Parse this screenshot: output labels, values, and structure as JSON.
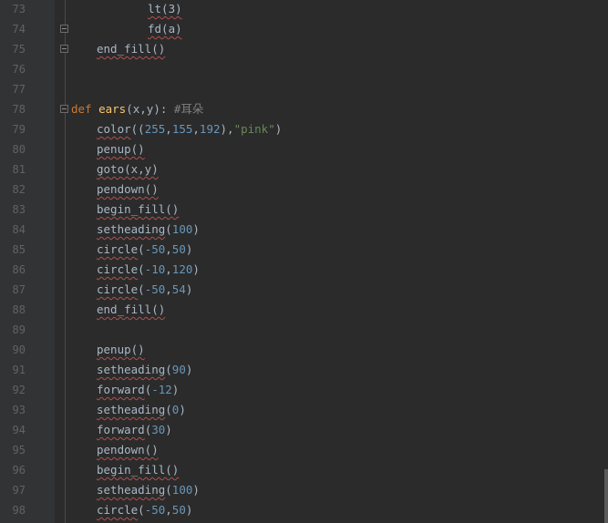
{
  "editor": {
    "lines": [
      {
        "num": "73",
        "text": "lt(3)"
      },
      {
        "num": "74",
        "text": "fd(a)"
      },
      {
        "num": "75",
        "text": "end_fill()"
      },
      {
        "num": "76",
        "text": ""
      },
      {
        "num": "77",
        "text": ""
      },
      {
        "num": "78",
        "def_kw": "def",
        "def_name": "ears",
        "def_rest": "(x,y):",
        "comment": "#耳朵"
      },
      {
        "num": "79",
        "call": "color",
        "args_a": "((",
        "n1": "255",
        "c1": ",",
        "n2": "155",
        "c2": ",",
        "n3": "192",
        "args_b": "),",
        "s1": "\"pink\"",
        "args_c": ")"
      },
      {
        "num": "80",
        "text": "penup()"
      },
      {
        "num": "81",
        "text": "goto(x,y)"
      },
      {
        "num": "82",
        "text": "pendown()"
      },
      {
        "num": "83",
        "text": "begin_fill()"
      },
      {
        "num": "84",
        "call": "setheading",
        "open": "(",
        "v": "100",
        "close": ")"
      },
      {
        "num": "85",
        "call": "circle",
        "open": "(",
        "v": "-50",
        "sep": ",",
        "v2": "50",
        "close": ")"
      },
      {
        "num": "86",
        "call": "circle",
        "open": "(",
        "v": "-10",
        "sep": ",",
        "v2": "120",
        "close": ")"
      },
      {
        "num": "87",
        "call": "circle",
        "open": "(",
        "v": "-50",
        "sep": ",",
        "v2": "54",
        "close": ")"
      },
      {
        "num": "88",
        "text": "end_fill()"
      },
      {
        "num": "89",
        "text": ""
      },
      {
        "num": "90",
        "text": "penup()"
      },
      {
        "num": "91",
        "call": "setheading",
        "open": "(",
        "v": "90",
        "close": ")"
      },
      {
        "num": "92",
        "call": "forward",
        "open": "(",
        "v": "-12",
        "close": ")"
      },
      {
        "num": "93",
        "call": "setheading",
        "open": "(",
        "v": "0",
        "close": ")"
      },
      {
        "num": "94",
        "call": "forward",
        "open": "(",
        "v": "30",
        "close": ")"
      },
      {
        "num": "95",
        "text": "pendown()"
      },
      {
        "num": "96",
        "text": "begin_fill()"
      },
      {
        "num": "97",
        "call": "setheading",
        "open": "(",
        "v": "100",
        "close": ")"
      },
      {
        "num": "98",
        "call": "circle",
        "open": "(",
        "v": "-50",
        "sep": ",",
        "v2": "50",
        "close": ")"
      }
    ],
    "partial_bottom": "pass0"
  },
  "colors": {
    "background": "#2b2b2b",
    "gutter": "#313335",
    "keyword": "#cc7832",
    "function": "#ffc66d",
    "number": "#6897bb",
    "string": "#6a8759",
    "comment": "#808080",
    "text": "#a9b7c6"
  }
}
